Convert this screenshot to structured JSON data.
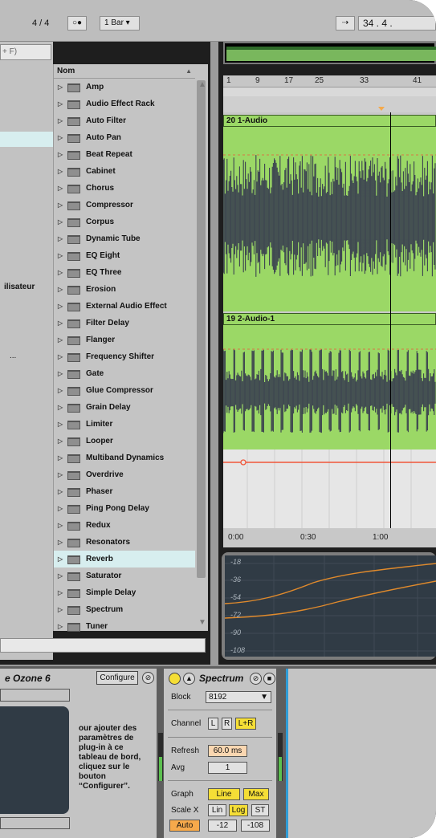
{
  "transport": {
    "signature": "4 / 4",
    "rec_mode": "○●",
    "quantize": "1 Bar ▾",
    "follow_icon": "follow-icon",
    "position": "34 .  4 ."
  },
  "browser": {
    "search_placeholder": "+ F)",
    "left_partial_label": "ilisateur",
    "left_partial_label2": "...",
    "column_header": "Nom",
    "items": [
      "Amp",
      "Audio Effect Rack",
      "Auto Filter",
      "Auto Pan",
      "Beat Repeat",
      "Cabinet",
      "Chorus",
      "Compressor",
      "Corpus",
      "Dynamic Tube",
      "EQ Eight",
      "EQ Three",
      "Erosion",
      "External Audio Effect",
      "Filter Delay",
      "Flanger",
      "Frequency Shifter",
      "Gate",
      "Glue Compressor",
      "Grain Delay",
      "Limiter",
      "Looper",
      "Multiband Dynamics",
      "Overdrive",
      "Phaser",
      "Ping Pong Delay",
      "Redux",
      "Resonators",
      "Reverb",
      "Saturator",
      "Simple Delay",
      "Spectrum",
      "Tuner"
    ],
    "selected_item": "Reverb"
  },
  "arrangement": {
    "bar_numbers": [
      "1",
      "9",
      "17",
      "25",
      "33",
      "41"
    ],
    "clips": [
      "20 1-Audio",
      "19 2-Audio-1"
    ],
    "time_labels": [
      "0:00",
      "0:30",
      "1:00"
    ]
  },
  "spectrum_display": {
    "db_labels": [
      "-18",
      "-36",
      "-54",
      "-72",
      "-90",
      "-108"
    ]
  },
  "devices": {
    "ozone": {
      "title": "e Ozone 6",
      "configure_label": "Configure",
      "description": "our ajouter des paramètres de plug-in à ce tableau de bord, cliquez sur le bouton “Configurer”."
    },
    "spectrum": {
      "title": "Spectrum",
      "block_label": "Block",
      "block_value": "8192",
      "channel_label": "Channel",
      "channel_options": [
        "L",
        "R",
        "L+R"
      ],
      "refresh_label": "Refresh",
      "refresh_value": "60.0 ms",
      "avg_label": "Avg",
      "avg_value": "1",
      "graph_label": "Graph",
      "graph_options": [
        "Line",
        "Max"
      ],
      "scale_label": "Scale X",
      "scale_options": [
        "Lin",
        "Log",
        "ST"
      ],
      "auto_label": "Auto",
      "range_low": "-12",
      "range_high": "-108"
    }
  },
  "colors": {
    "clip_green": "#9bd866",
    "selection": "#d7eeef",
    "waveform": "#3b4250",
    "automation_red": "#f0563a",
    "spectrum_orange": "#e08a2c",
    "toggle_on": "#f5de36"
  }
}
